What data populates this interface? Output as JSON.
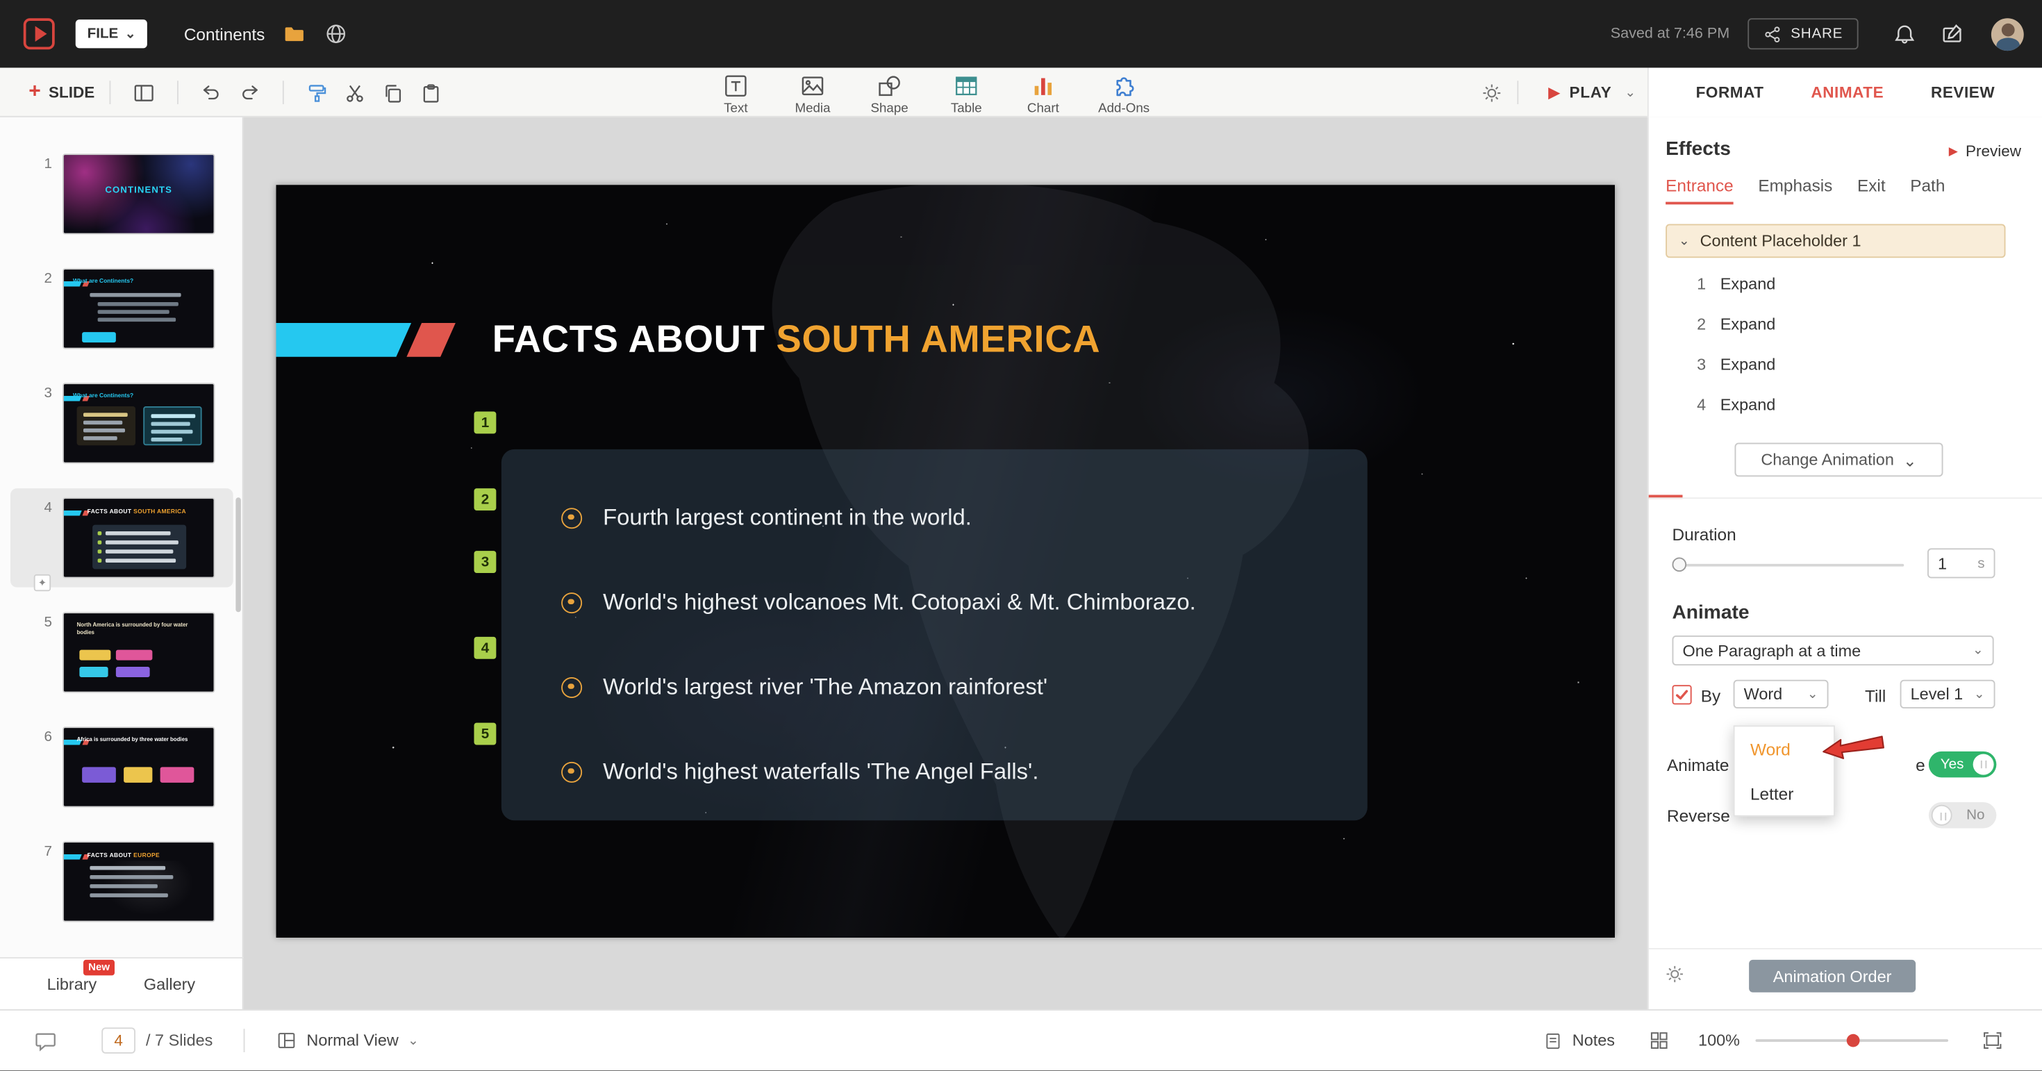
{
  "colors": {
    "accent_red": "#e0564d",
    "accent_orange": "#f0a330",
    "accent_cyan": "#25c8f0",
    "badge_green": "#a9cf4b",
    "toggle_on_green": "#2fb56b",
    "brand_red": "#d8453e"
  },
  "glyphs": {
    "chevron_down": "⌄",
    "play": "▶",
    "plus": "+",
    "star": "✦"
  },
  "topbar": {
    "file_button": "FILE",
    "doc_title": "Continents",
    "saved_status": "Saved at 7:46 PM",
    "share_button": "SHARE"
  },
  "toolbar": {
    "slide_button": "SLIDE",
    "insert_tools": [
      {
        "label": "Text"
      },
      {
        "label": "Media"
      },
      {
        "label": "Shape"
      },
      {
        "label": "Table"
      },
      {
        "label": "Chart"
      },
      {
        "label": "Add-Ons"
      }
    ],
    "play_button": "PLAY",
    "ribbon_tabs": [
      {
        "label": "FORMAT"
      },
      {
        "label": "ANIMATE"
      },
      {
        "label": "REVIEW"
      }
    ]
  },
  "sidebar": {
    "slides": [
      {
        "num": "1",
        "title": "CONTINENTS"
      },
      {
        "num": "2",
        "title": "What are Continents?"
      },
      {
        "num": "3",
        "title": "What are Continents?"
      },
      {
        "num": "4",
        "title_prefix": "FACTS ABOUT ",
        "title_accent": "SOUTH AMERICA"
      },
      {
        "num": "5",
        "title": "North America is surrounded by four water bodies"
      },
      {
        "num": "6",
        "title": "Africa is surrounded by three water bodies"
      },
      {
        "num": "7",
        "title_prefix": "FACTS ABOUT ",
        "title_accent": "EUROPE"
      }
    ],
    "library_tab": "Library",
    "library_badge": "New",
    "gallery_tab": "Gallery"
  },
  "slide": {
    "title_prefix": "FACTS ABOUT ",
    "title_accent": "SOUTH AMERICA",
    "badges": [
      "1",
      "2",
      "3",
      "4",
      "5"
    ],
    "bullets": [
      {
        "text": "Fourth largest continent in the world."
      },
      {
        "text": "World's highest volcanoes Mt. Cotopaxi & Mt. Chimborazo."
      },
      {
        "text": "World's largest river 'The Amazon rainforest'"
      },
      {
        "text": "World's highest waterfalls 'The Angel Falls'."
      }
    ]
  },
  "effects_panel": {
    "title": "Effects",
    "preview": "Preview",
    "tabs": [
      {
        "label": "Entrance"
      },
      {
        "label": "Emphasis"
      },
      {
        "label": "Exit"
      },
      {
        "label": "Path"
      }
    ],
    "group_header": "Content Placeholder 1",
    "effects": [
      {
        "order": "1",
        "name": "Expand"
      },
      {
        "order": "2",
        "name": "Expand"
      },
      {
        "order": "3",
        "name": "Expand"
      },
      {
        "order": "4",
        "name": "Expand"
      }
    ],
    "change_animation": "Change Animation",
    "duration_label": "Duration",
    "duration_value": "1",
    "duration_unit": "s",
    "animate_heading": "Animate",
    "paragraph_mode": "One Paragraph at a time",
    "by_label": "By",
    "by_value": "Word",
    "till_label": "Till",
    "till_value": "Level 1",
    "menu_options": [
      {
        "label": "Word"
      },
      {
        "label": "Letter"
      }
    ],
    "animate_row_label": "Animate",
    "animate_row_label_tail": "e",
    "animate_toggle": "Yes",
    "reverse_row_label": "Reverse",
    "reverse_toggle": "No",
    "animation_order_button": "Animation Order"
  },
  "statusbar": {
    "current_slide": "4",
    "slides_total": "/ 7 Slides",
    "view_mode": "Normal View",
    "notes": "Notes",
    "zoom": "100%"
  }
}
